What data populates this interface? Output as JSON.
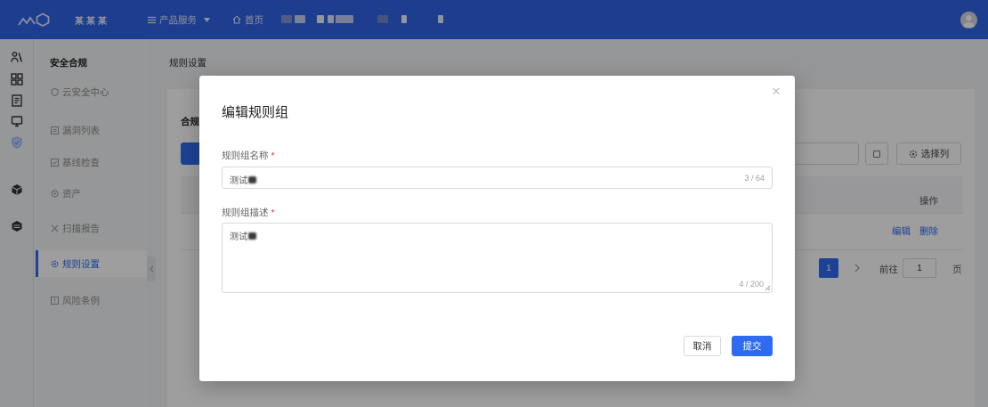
{
  "colors": {
    "accent": "#2f6bf0",
    "header": "#3064e6",
    "required": "#f5222d"
  },
  "header": {
    "logo_text": "某某某",
    "product_menu": "产品服务",
    "home": "首页",
    "avatar_icon": "user-avatar-icon"
  },
  "icon_sidebar": [
    {
      "icon": "people-icon"
    },
    {
      "icon": "grid-icon"
    },
    {
      "icon": "document-icon"
    },
    {
      "icon": "monitor-icon"
    },
    {
      "icon": "shield-icon",
      "active": true
    },
    {
      "icon": "cube-icon"
    },
    {
      "icon": "database-icon"
    }
  ],
  "sidebar": {
    "title": "安全合规",
    "items": [
      {
        "label": "云安全中心",
        "icon": "shield-small-icon"
      },
      {
        "label": "漏洞列表",
        "icon": "list-icon"
      },
      {
        "label": "基线检查",
        "icon": "checklist-icon"
      },
      {
        "label": "资产",
        "icon": "asset-icon"
      },
      {
        "label": "扫描报告",
        "icon": "scan-icon"
      },
      {
        "label": "规则设置",
        "icon": "rule-icon",
        "selected": true
      },
      {
        "label": "风险条例",
        "icon": "risk-icon"
      }
    ]
  },
  "main": {
    "breadcrumb": "规则设置",
    "card_title": "合规",
    "toolbar": {
      "column_selector": "选择列"
    },
    "table": {
      "headers": [
        "操作"
      ],
      "rows": [
        {
          "actions": [
            "编辑",
            "删除"
          ]
        }
      ]
    },
    "pagination": {
      "current_page": "1",
      "goto_label": "前往",
      "goto_value": "1",
      "page_suffix": "页"
    }
  },
  "modal": {
    "title": "编辑规则组",
    "close_label": "×",
    "name_field": {
      "label": "规则组名称",
      "required_mark": "*",
      "value": "测试",
      "counter": "3 / 64"
    },
    "desc_field": {
      "label": "规则组描述",
      "required_mark": "*",
      "value": "测试",
      "counter": "4 / 200"
    },
    "cancel_label": "取消",
    "submit_label": "提交"
  }
}
